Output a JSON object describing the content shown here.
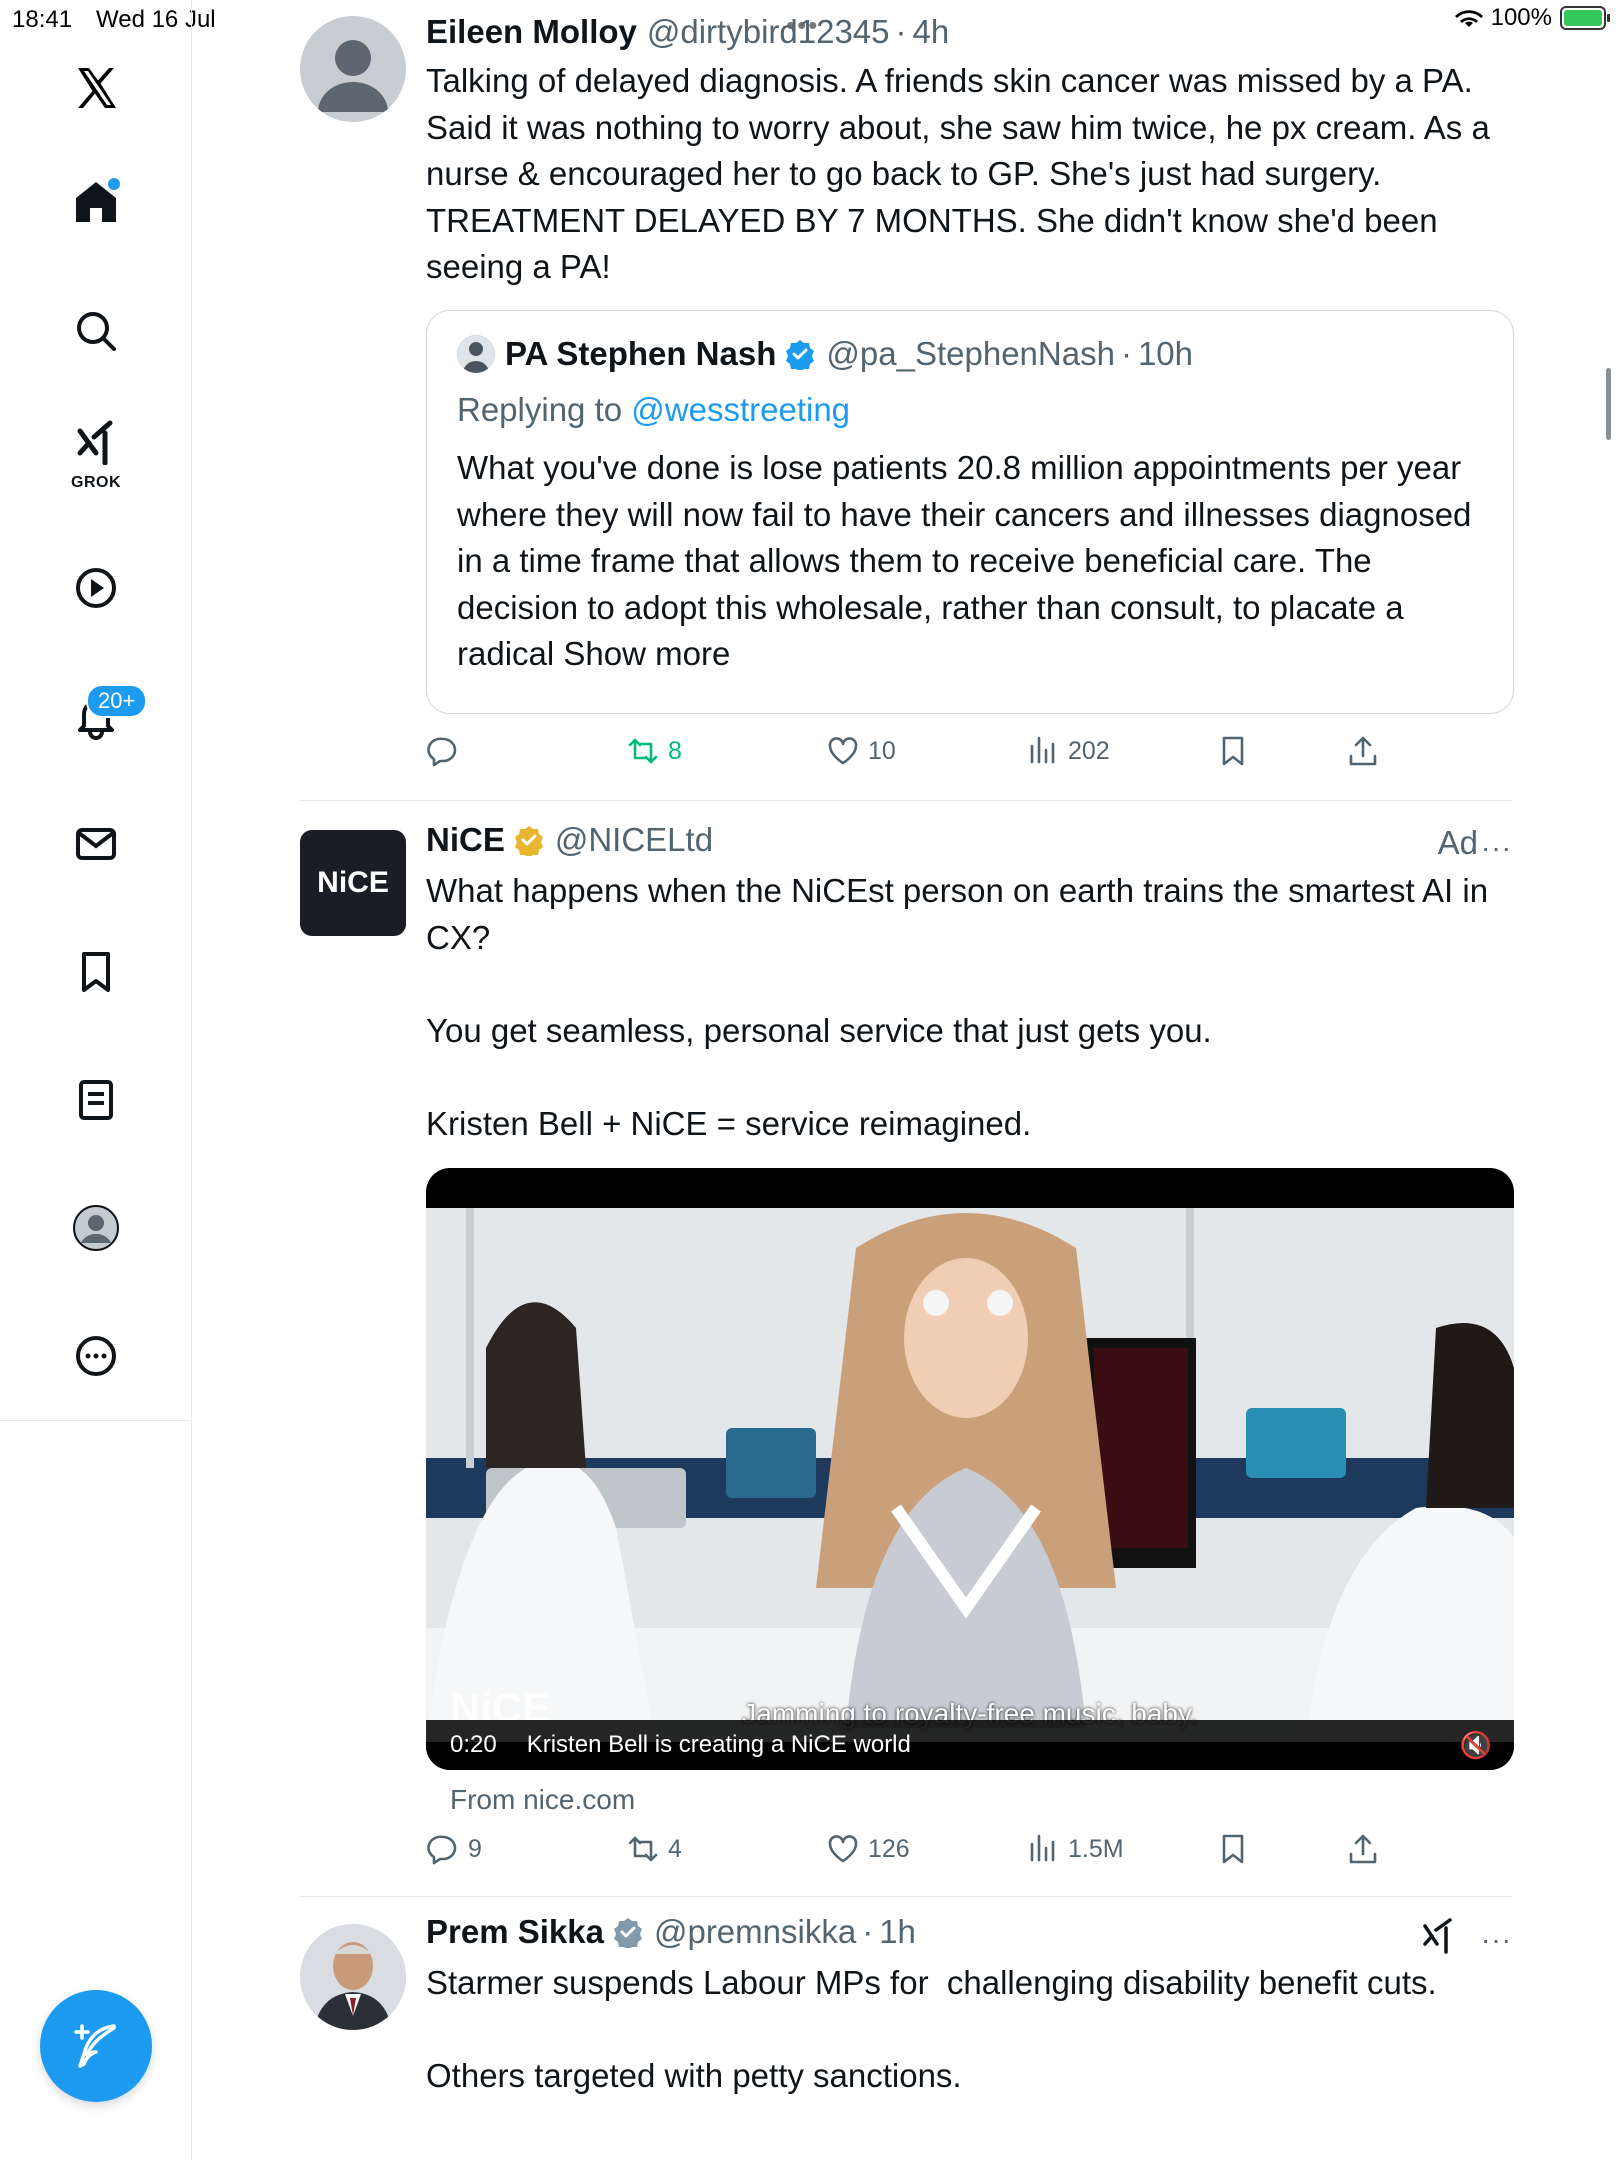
{
  "status_bar": {
    "time": "18:41",
    "date": "Wed 16 Jul",
    "battery": "100%"
  },
  "sidebar": {
    "grok_label": "GROK",
    "notifications_badge": "20+"
  },
  "tweets": [
    {
      "name": "Eileen Molloy",
      "handle": "@dirtybird12345",
      "sep": "·",
      "time": "4h",
      "text": "Talking of delayed diagnosis. A friends skin cancer was missed by a PA. Said it was nothing to worry about, she saw him twice, he px cream. As a nurse & encouraged her to go back to GP. She's just had surgery. TREATMENT DELAYED BY 7 MONTHS. She didn't know she'd been seeing a PA!",
      "quote": {
        "name": "PA Stephen Nash",
        "handle": "@pa_StephenNash",
        "sep": "·",
        "time": "10h",
        "replying_prefix": "Replying to",
        "replying_handle": "@wesstreeting",
        "text": "What you've done is lose patients 20.8 million appointments per year where they will now fail to have their cancers and illnesses diagnosed in a time frame that allows them to receive beneficial care. The decision to adopt this wholesale, rather than consult, to placate a radical",
        "show_more": "Show more"
      },
      "actions": {
        "replies": "",
        "reposts": "8",
        "likes": "10",
        "views": "202"
      }
    },
    {
      "name": "NiCE",
      "handle": "@NICELtd",
      "ad_label": "Ad",
      "avatar_text": "NiCE",
      "text": "What happens when the NiCEst person on earth trains the smartest AI in CX?\n\nYou get seamless, personal service that just gets you.\n\nKristen Bell + NiCE = service reimagined.",
      "video": {
        "logo": "NiCE",
        "subtitle": "Jamming to royalty-free music, baby.",
        "timestamp": "0:20",
        "caption": "Kristen Bell is creating a NiCE world"
      },
      "from": "From nice.com",
      "actions": {
        "replies": "9",
        "reposts": "4",
        "likes": "126",
        "views": "1.5M"
      }
    },
    {
      "name": "Prem Sikka",
      "handle": "@premnsikka",
      "sep": "·",
      "time": "1h",
      "text": "Starmer suspends Labour MPs for  challenging disability benefit cuts.\n\nOthers targeted with petty sanctions."
    }
  ],
  "colors": {
    "accent": "#1d9bf0",
    "repost_green": "#00ba7c",
    "muted": "#536471",
    "gold": "#e8b631"
  }
}
